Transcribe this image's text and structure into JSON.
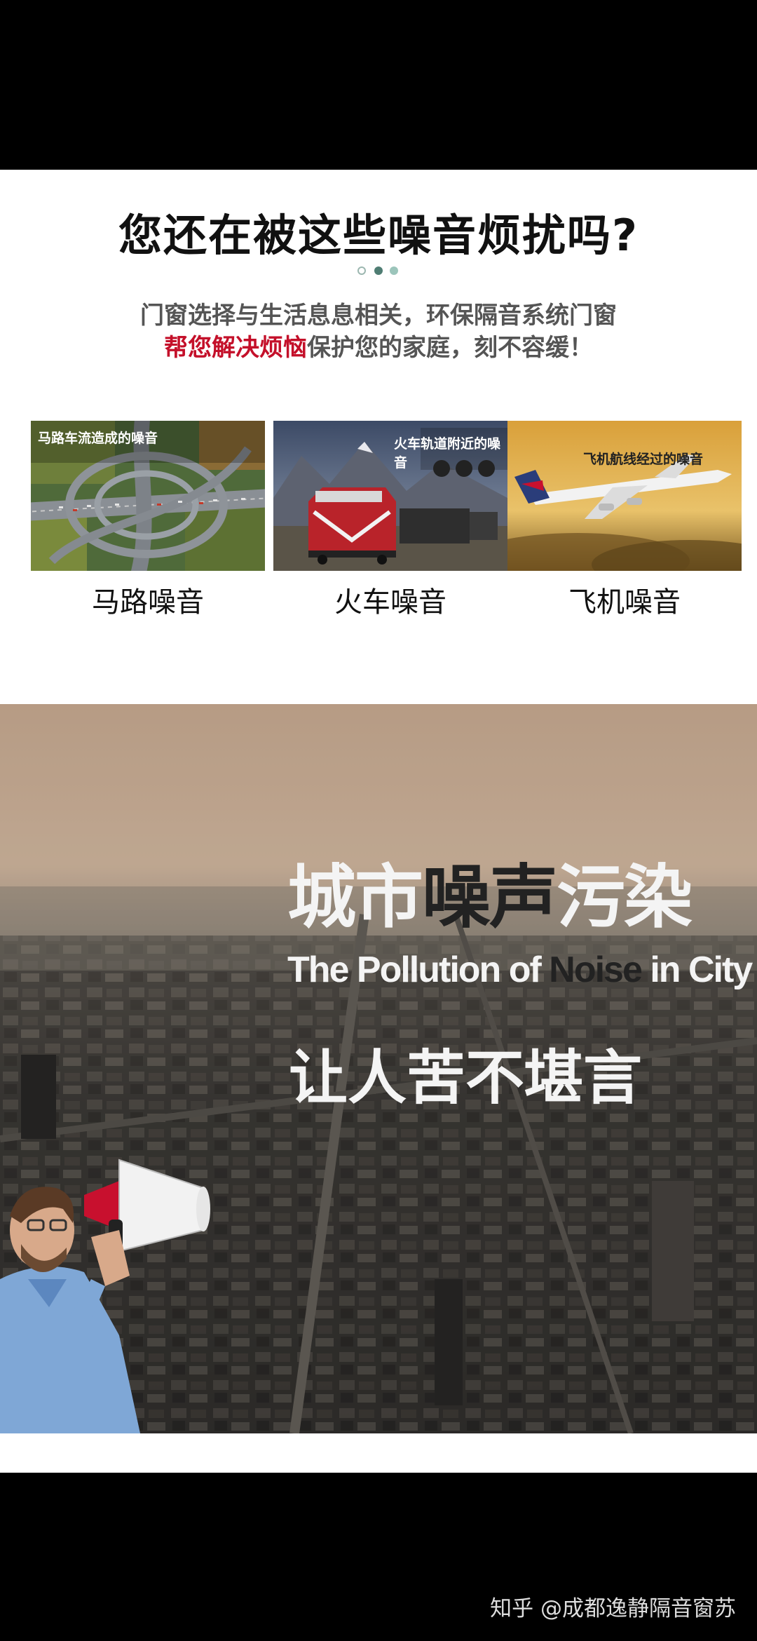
{
  "headline": "您还在被这些噪音烦扰吗?",
  "subtitle": {
    "line1": "门窗选择与生活息息相关，环保隔音系统门窗",
    "line2_highlight": "帮您解决烦恼",
    "line2_rest": "保护您的家庭，刻不容缓！"
  },
  "cards": [
    {
      "image_title": "马路车流造成的噪音",
      "caption": "马路噪音"
    },
    {
      "image_title": "火车轨道附近的噪音",
      "caption": "火车噪音"
    },
    {
      "image_title": "飞机航线经过的噪音",
      "caption": "飞机噪音"
    }
  ],
  "city_banner": {
    "title_part1": "城市",
    "title_part2": "噪声",
    "title_part3": "污染",
    "english_part1": "The Pollution of ",
    "english_part2": "Noise",
    "english_part3": " in City",
    "tagline": "让人苦不堪言"
  },
  "watermark": "知乎 @成都逸静隔音窗苏",
  "colors": {
    "highlight": "#c4102a",
    "pagination_active": "#4f7d73"
  }
}
